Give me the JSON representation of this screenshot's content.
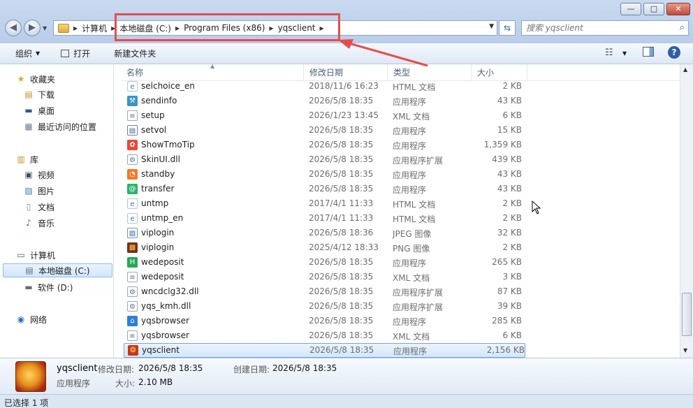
{
  "window": {
    "minimize_label": "—",
    "maximize_label": "□",
    "close_label": "✕"
  },
  "address": {
    "crumbs": [
      "计算机",
      "本地磁盘 (C:)",
      "Program Files (x86)",
      "yqsclient"
    ]
  },
  "search": {
    "placeholder": "搜索 yqsclient"
  },
  "toolbar": {
    "organize_label": "组织",
    "open_label": "打开",
    "new_folder_label": "新建文件夹"
  },
  "nav": {
    "favorites": "收藏夹",
    "downloads": "下载",
    "desktop": "桌面",
    "recent": "最近访问的位置",
    "libraries": "库",
    "videos": "视频",
    "pictures": "图片",
    "documents": "文档",
    "music": "音乐",
    "computer": "计算机",
    "local_disk": "本地磁盘 (C:)",
    "software_disk": "软件 (D:)",
    "network": "网络"
  },
  "columns": {
    "name": "名称",
    "date": "修改日期",
    "type": "类型",
    "size": "大小"
  },
  "files": [
    {
      "name": "selchoice_en",
      "date": "2018/11/6 16:23",
      "type": "HTML 文档",
      "size": "2 KB",
      "icon": "ie-html-icon"
    },
    {
      "name": "sendinfo",
      "date": "2026/5/8 18:35",
      "type": "应用程序",
      "size": "43 KB",
      "icon": "app-icon"
    },
    {
      "name": "setup",
      "date": "2026/1/23 13:45",
      "type": "XML 文档",
      "size": "6 KB",
      "icon": "xml-icon"
    },
    {
      "name": "setvol",
      "date": "2026/5/8 18:35",
      "type": "应用程序",
      "size": "15 KB",
      "icon": "window-app-icon"
    },
    {
      "name": "ShowTmoTip",
      "date": "2026/5/8 18:35",
      "type": "应用程序",
      "size": "1,359 KB",
      "icon": "colorful-app-icon"
    },
    {
      "name": "SkinUI.dll",
      "date": "2026/5/8 18:35",
      "type": "应用程序扩展",
      "size": "439 KB",
      "icon": "dll-icon"
    },
    {
      "name": "standby",
      "date": "2026/5/8 18:35",
      "type": "应用程序",
      "size": "43 KB",
      "icon": "orange-app-icon"
    },
    {
      "name": "transfer",
      "date": "2026/5/8 18:35",
      "type": "应用程序",
      "size": "43 KB",
      "icon": "green-app-icon"
    },
    {
      "name": "untmp",
      "date": "2017/4/1 11:33",
      "type": "HTML 文档",
      "size": "2 KB",
      "icon": "ie-html-icon"
    },
    {
      "name": "untmp_en",
      "date": "2017/4/1 11:33",
      "type": "HTML 文档",
      "size": "2 KB",
      "icon": "ie-html-icon"
    },
    {
      "name": "viplogin",
      "date": "2026/5/8 18:36",
      "type": "JPEG 图像",
      "size": "32 KB",
      "icon": "jpeg-icon"
    },
    {
      "name": "viplogin",
      "date": "2025/4/12 18:33",
      "type": "PNG 图像",
      "size": "2 KB",
      "icon": "png-icon"
    },
    {
      "name": "wedeposit",
      "date": "2026/5/8 18:35",
      "type": "应用程序",
      "size": "265 KB",
      "icon": "green-h-app-icon"
    },
    {
      "name": "wedeposit",
      "date": "2026/5/8 18:35",
      "type": "XML 文档",
      "size": "3 KB",
      "icon": "xml-icon"
    },
    {
      "name": "wncdclg32.dll",
      "date": "2026/5/8 18:35",
      "type": "应用程序扩展",
      "size": "87 KB",
      "icon": "dll-icon"
    },
    {
      "name": "yqs_kmh.dll",
      "date": "2026/5/8 18:35",
      "type": "应用程序扩展",
      "size": "39 KB",
      "icon": "dll-icon"
    },
    {
      "name": "yqsbrowser",
      "date": "2026/5/8 18:35",
      "type": "应用程序",
      "size": "285 KB",
      "icon": "home-app-icon"
    },
    {
      "name": "yqsbrowser",
      "date": "2026/5/8 18:35",
      "type": "XML 文档",
      "size": "6 KB",
      "icon": "xml-icon"
    },
    {
      "name": "yqsclient",
      "date": "2026/5/8 18:35",
      "type": "应用程序",
      "size": "2,156 KB",
      "icon": "dragon-app-icon",
      "selected": true
    }
  ],
  "details": {
    "name": "yqsclient",
    "modified_label": "修改日期:",
    "modified_value": "2026/5/8 18:35",
    "created_label": "创建日期:",
    "created_value": "2026/5/8 18:35",
    "type": "应用程序",
    "size_label": "大小:",
    "size_value": "2.10 MB"
  },
  "status": {
    "text": "已选择 1 项"
  },
  "colors": {
    "highlight": "#e94b4b",
    "selection_border": "#7da2ce"
  }
}
